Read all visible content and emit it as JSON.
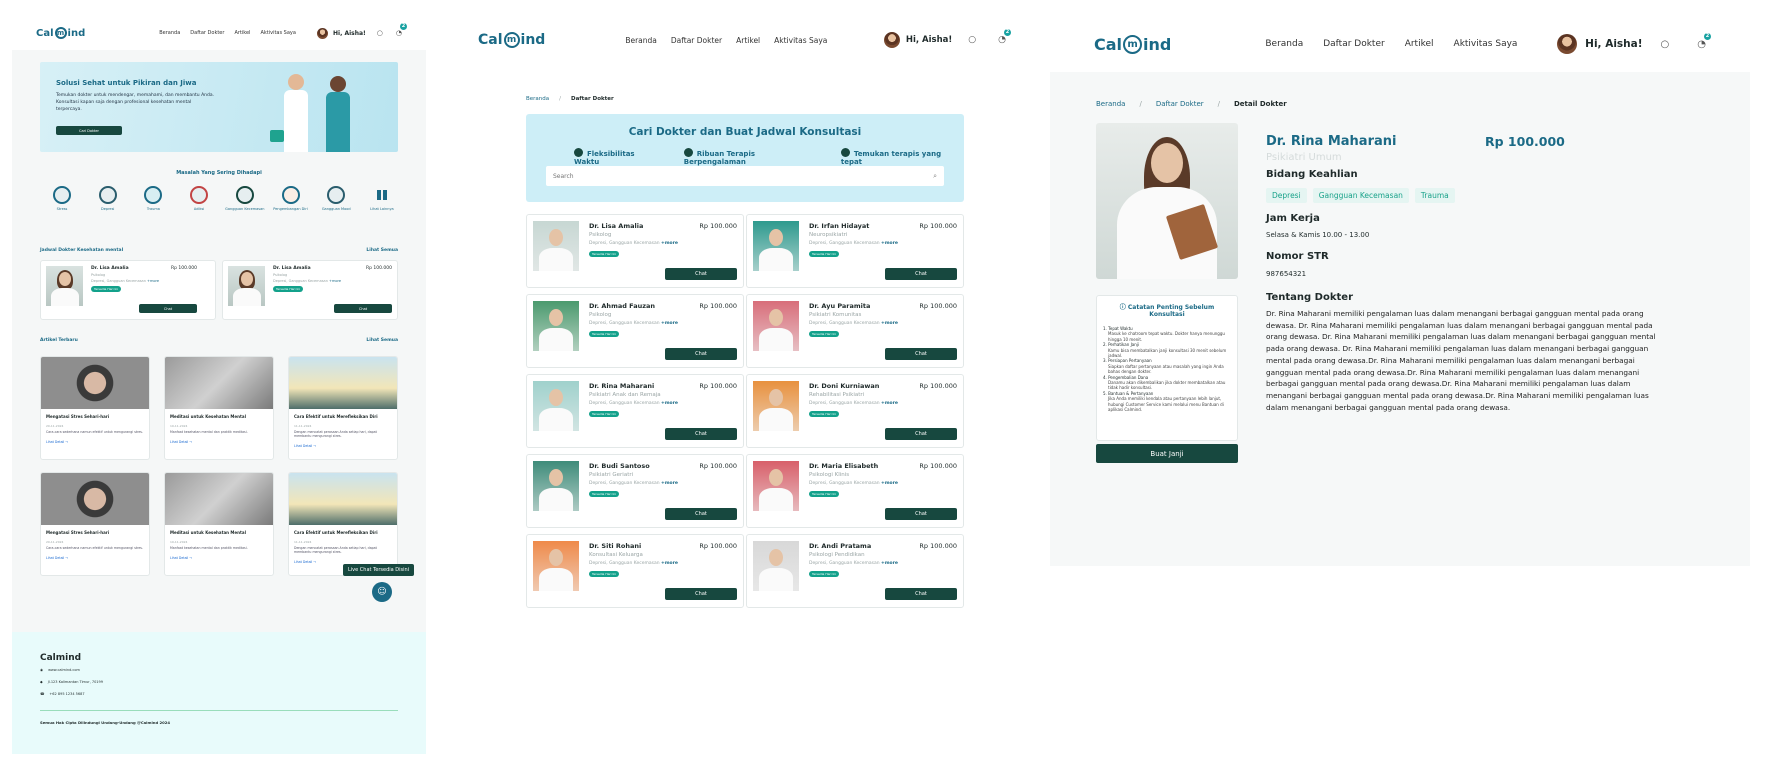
{
  "brand": {
    "logo_left": "Cal",
    "logo_mid": "m",
    "logo_right": "ind",
    "accent": "#1b6a86",
    "dark": "#17483f"
  },
  "nav": {
    "links": [
      "Beranda",
      "Daftar Dokter",
      "Artikel",
      "Aktivitas Saya"
    ],
    "greeting": "Hi, Aisha!",
    "notif_count": "2"
  },
  "home": {
    "hero": {
      "title": "Solusi Sehat untuk Pikiran dan Jiwa",
      "text": "Temukan dokter untuk mendengar, memahami, dan membantu Anda. Konsultasi kapan saja dengan profesional kesehatan mental terpercaya.",
      "cta": "Cari Dokter"
    },
    "issues_title": "Masalah Yang Sering Dihadapi",
    "issues": [
      "Stress",
      "Depresi",
      "Trauma",
      "Adiksi",
      "Gangguan Kecemasan",
      "Pengembangan Diri",
      "Gangguan Mood",
      "Lihat Lainnya"
    ],
    "schedule_title": "Jadwal Dokter Kesehatan mental",
    "see_all": "Lihat Semua",
    "doctors": [
      {
        "name": "Dr. Lisa Amalia",
        "price": "Rp 100.000",
        "role": "Psikolog",
        "skills": "Depresi, Gangguan Kecemasan",
        "more": "+more",
        "tag": "Tersedia Hari Ini",
        "cta": "Chat"
      },
      {
        "name": "Dr. Lisa Amalia",
        "price": "Rp 100.000",
        "role": "Psikolog",
        "skills": "Depresi, Gangguan Kecemasan",
        "more": "+more",
        "tag": "Tersedia Hari Ini",
        "cta": "Chat"
      }
    ],
    "articles_title": "Artikel Terbaru",
    "articles": [
      {
        "title": "Mengatasi Stres Sehari-hari",
        "date": "20-11-2024",
        "text": "Cara-cara sederhana namun efektif untuk mengurangi stres.",
        "link": "Lihat Detail →"
      },
      {
        "title": "Meditasi untuk Kesehatan Mental",
        "date": "19-11-2024",
        "text": "Manfaat kesehatan mental dan praktik meditasi.",
        "link": "Lihat Detail →"
      },
      {
        "title": "Cara Efektif untuk Merefleksikan Diri",
        "date": "11-11-2024",
        "text": "Dengan mencatat perasaan Anda setiap hari, dapat membantu mengurangi stres.",
        "link": "Lihat Detail →"
      },
      {
        "title": "Mengatasi Stres Sehari-hari",
        "date": "20-11-2024",
        "text": "Cara-cara sederhana namun efektif untuk mengurangi stres.",
        "link": "Lihat Detail →"
      },
      {
        "title": "Meditasi untuk Kesehatan Mental",
        "date": "19-11-2024",
        "text": "Manfaat kesehatan mental dan praktik meditasi.",
        "link": "Lihat Detail →"
      },
      {
        "title": "Cara Efektif untuk Merefleksikan Diri",
        "date": "11-11-2024",
        "text": "Dengan mencatat perasaan Anda setiap hari, dapat membantu mengurangi stres.",
        "link": "Lihat Detail →"
      }
    ],
    "live_chat": "Live Chat Tersedia Disini",
    "footer": {
      "brand": "Calmind",
      "web": "www.calmind.com",
      "address": "Jl.123 Kalimantan Timur, 70199",
      "phone": "+62 895 1234 5687",
      "copyright": "Semua Hak Cipta Dilindungi Undang-Undang @Calmind 2024"
    }
  },
  "list": {
    "breadcrumb": [
      "Beranda",
      "Daftar Dokter"
    ],
    "title": "Cari Dokter dan Buat Jadwal Konsultasi",
    "features": [
      "Fleksibilitas Waktu",
      "Ribuan Terapis Berpengalaman",
      "Temukan terapis yang tepat"
    ],
    "search_placeholder": "Search",
    "doctors": [
      {
        "name": "Dr. Lisa Amalia",
        "price": "Rp 100.000",
        "role": "Psikolog",
        "skills": "Depresi, Gangguan Kecemasan",
        "more": "+more",
        "tag": "Tersedia Hari Ini",
        "cta": "Chat"
      },
      {
        "name": "Dr. Irfan Hidayat",
        "price": "Rp 100.000",
        "role": "Neuropsikiatri",
        "skills": "Depresi, Gangguan Kecemasan",
        "more": "+more",
        "tag": "Tersedia Hari Ini",
        "cta": "Chat"
      },
      {
        "name": "Dr. Ahmad Fauzan",
        "price": "Rp 100.000",
        "role": "Psikolog",
        "skills": "Depresi, Gangguan Kecemasan",
        "more": "+more",
        "tag": "Tersedia Hari Ini",
        "cta": "Chat"
      },
      {
        "name": "Dr. Ayu Paramita",
        "price": "Rp 100.000",
        "role": "Psikiatri Komunitas",
        "skills": "Depresi, Gangguan Kecemasan",
        "more": "+more",
        "tag": "Tersedia Hari Ini",
        "cta": "Chat"
      },
      {
        "name": "Dr. Rina Maharani",
        "price": "Rp 100.000",
        "role": "Psikiatri Anak dan Remaja",
        "skills": "Depresi, Gangguan Kecemasan",
        "more": "+more",
        "tag": "Tersedia Hari Ini",
        "cta": "Chat"
      },
      {
        "name": "Dr. Doni Kurniawan",
        "price": "Rp 100.000",
        "role": "Rehabilitasi Psikiatri",
        "skills": "Depresi, Gangguan Kecemasan",
        "more": "+more",
        "tag": "Tersedia Hari Ini",
        "cta": "Chat"
      },
      {
        "name": "Dr. Budi Santoso",
        "price": "Rp 100.000",
        "role": "Psikiatri Geriatri",
        "skills": "Depresi, Gangguan Kecemasan",
        "more": "+more",
        "tag": "Tersedia Hari Ini",
        "cta": "Chat"
      },
      {
        "name": "Dr. Maria Elisabeth",
        "price": "Rp 100.000",
        "role": "Psikologi Klinis",
        "skills": "Depresi, Gangguan Kecemasan",
        "more": "+more",
        "tag": "Tersedia Hari Ini",
        "cta": "Chat"
      },
      {
        "name": "Dr. Siti Rohani",
        "price": "Rp 100.000",
        "role": "Konsultasi Keluarga",
        "skills": "Depresi, Gangguan Kecemasan",
        "more": "+more",
        "tag": "Tersedia Hari Ini",
        "cta": "Chat"
      },
      {
        "name": "Dr. Andi Pratama",
        "price": "Rp 100.000",
        "role": "Psikologi Pendidikan",
        "skills": "Depresi, Gangguan Kecemasan",
        "more": "+more",
        "tag": "Tersedia Hari Ini",
        "cta": "Chat"
      }
    ]
  },
  "detail": {
    "breadcrumb": [
      "Beranda",
      "Daftar Dokter",
      "Detail Dokter"
    ],
    "name": "Dr. Rina Maharani",
    "price": "Rp 100.000",
    "role": "Psikiatri Umum",
    "skills_title": "Bidang Keahlian",
    "skills": [
      "Depresi",
      "Gangguan Kecemasan",
      "Trauma"
    ],
    "hours_title": "Jam Kerja",
    "hours": "Selasa & Kamis 10.00 - 13.00",
    "str_title": "Nomor STR",
    "str": "987654321",
    "about_title": "Tentang Dokter",
    "about": "Dr. Rina Maharani memiliki pengalaman luas dalam menangani berbagai gangguan mental pada orang dewasa. Dr. Rina Maharani memiliki pengalaman luas dalam menangani berbagai gangguan mental pada orang dewasa. Dr. Rina Maharani memiliki pengalaman luas dalam menangani berbagai gangguan mental pada orang dewasa. Dr. Rina Maharani memiliki pengalaman luas dalam menangani berbagai gangguan mental pada orang dewasa.Dr. Rina Maharani memiliki pengalaman luas dalam menangani berbagai gangguan mental pada orang dewasa.Dr. Rina Maharani memiliki pengalaman luas dalam menangani berbagai gangguan mental pada orang dewasa.Dr. Rina Maharani memiliki pengalaman luas dalam menangani berbagai gangguan mental pada orang dewasa.Dr. Rina Maharani memiliki pengalaman luas dalam menangani berbagai gangguan mental pada orang dewasa.",
    "notes_title": "Catatan Penting Sebelum Konsultasi",
    "notes": [
      {
        "t": "1. Tepat Waktu",
        "d": "Masuk ke chatroom tepat waktu. Dokter hanya menunggu hingga 10 menit."
      },
      {
        "t": "2. Perhatikan Janji",
        "d": "Kamu bisa membatalkan janji konsultasi 30 menit sebelum jadwal."
      },
      {
        "t": "3. Persiapan Pertanyaan",
        "d": "Siapkan daftar pertanyaan atau masalah yang ingin Anda bahas dengan dokter."
      },
      {
        "t": "4. Pengembalian Dana",
        "d": "Danamu akan dikembalikan jika dokter membatalkan atau tidak hadir konsultasi."
      },
      {
        "t": "5. Bantuan & Pertanyaan",
        "d": "Jika Anda memiliki kendala atau pertanyaan lebih lanjut, hubungi Customer Service kami melalui menu Bantuan di aplikasi Calmind."
      }
    ],
    "cta": "Buat Janji"
  }
}
